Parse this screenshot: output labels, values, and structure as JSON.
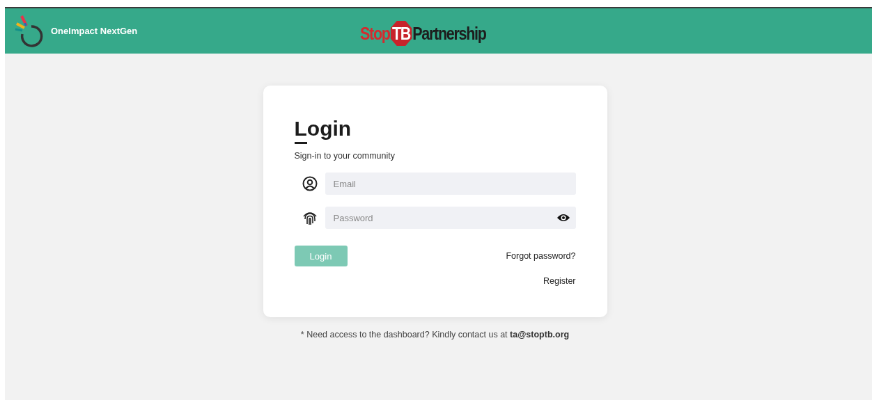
{
  "header": {
    "app_name": "OneImpact NextGen",
    "partner_logo": {
      "stop": "Stop",
      "badge": "TB",
      "rest": "Partnership"
    }
  },
  "login_card": {
    "title": "Login",
    "subtitle": "Sign-in to your community",
    "fields": [
      {
        "kind": "email",
        "placeholder": "Email"
      },
      {
        "kind": "password",
        "placeholder": "Password"
      }
    ],
    "login_button": {
      "label": "Login",
      "disabled": true
    },
    "links": [
      "Forgot password?",
      "Register"
    ]
  },
  "footer_note": "* Need access to the dashboard? Kindly contact us at **ta@stoptb.org**"
}
